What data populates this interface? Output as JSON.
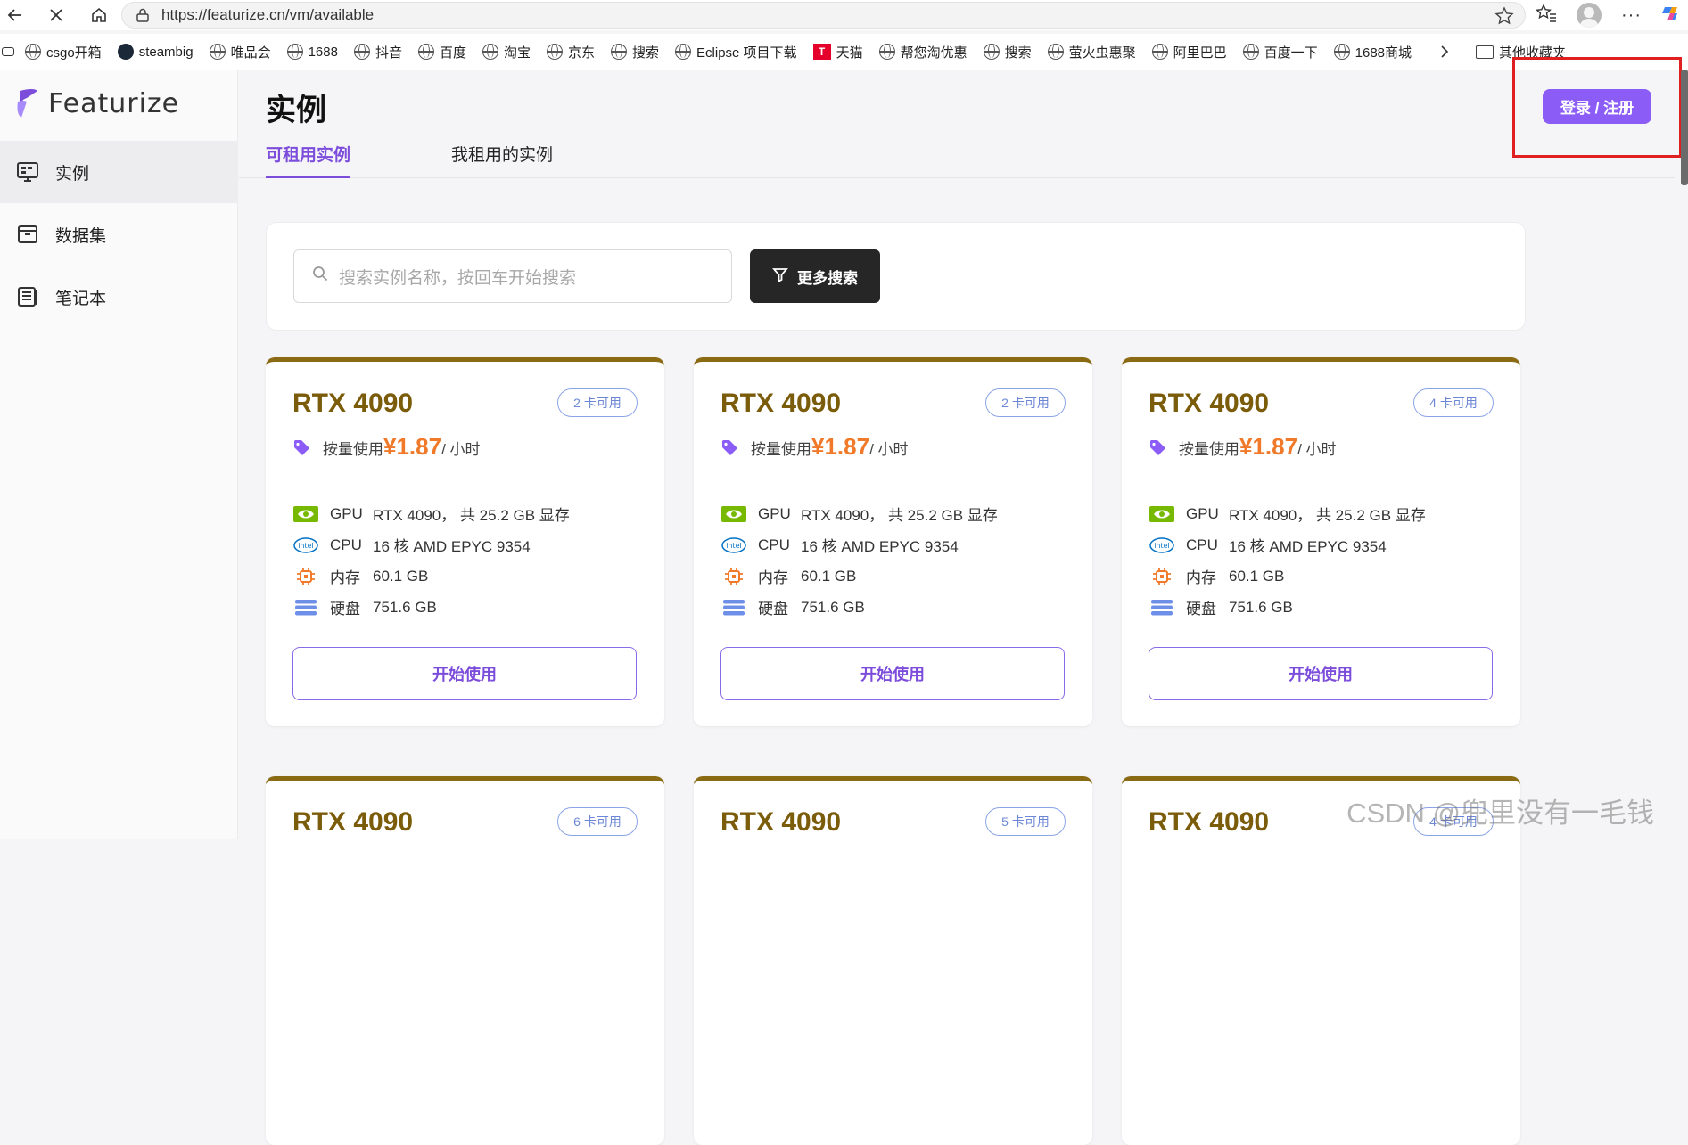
{
  "browser": {
    "url": "https://featurize.cn/vm/available",
    "bookmarks": [
      "csgo开箱",
      "steambig",
      "唯品会",
      "1688",
      "抖音",
      "百度",
      "淘宝",
      "京东",
      "搜索",
      "Eclipse 项目下载",
      "天猫",
      "帮您淘优惠",
      "搜索",
      "萤火虫惠聚",
      "阿里巴巴",
      "百度一下",
      "1688商城"
    ],
    "other_bookmarks": "其他收藏夹"
  },
  "brand": {
    "name": "Featurize",
    "accent": "#8b5cf6"
  },
  "sidebar": {
    "items": [
      {
        "label": "实例",
        "icon": "monitor-icon",
        "active": true
      },
      {
        "label": "数据集",
        "icon": "archive-icon",
        "active": false
      },
      {
        "label": "笔记本",
        "icon": "notebook-icon",
        "active": false
      }
    ]
  },
  "main": {
    "title": "实例",
    "login_label": "登录 / 注册",
    "tabs": [
      "可租用实例",
      "我租用的实例"
    ],
    "search_placeholder": "搜索实例名称，按回车开始搜索",
    "more_search_label": "更多搜索"
  },
  "cards": [
    {
      "title": "RTX 4090",
      "badge": "2 卡可用",
      "price_prefix": "按量使用",
      "price": "¥1.87",
      "price_unit": "/ 小时",
      "gpu_label": "GPU",
      "gpu": "RTX 4090， 共 25.2 GB 显存",
      "cpu_label": "CPU",
      "cpu": "16 核 AMD EPYC 9354",
      "mem_label": "内存",
      "mem": "60.1 GB",
      "disk_label": "硬盘",
      "disk": "751.6 GB",
      "button": "开始使用"
    },
    {
      "title": "RTX 4090",
      "badge": "2 卡可用",
      "price_prefix": "按量使用",
      "price": "¥1.87",
      "price_unit": "/ 小时",
      "gpu_label": "GPU",
      "gpu": "RTX 4090， 共 25.2 GB 显存",
      "cpu_label": "CPU",
      "cpu": "16 核 AMD EPYC 9354",
      "mem_label": "内存",
      "mem": "60.1 GB",
      "disk_label": "硬盘",
      "disk": "751.6 GB",
      "button": "开始使用"
    },
    {
      "title": "RTX 4090",
      "badge": "4 卡可用",
      "price_prefix": "按量使用",
      "price": "¥1.87",
      "price_unit": "/ 小时",
      "gpu_label": "GPU",
      "gpu": "RTX 4090， 共 25.2 GB 显存",
      "cpu_label": "CPU",
      "cpu": "16 核 AMD EPYC 9354",
      "mem_label": "内存",
      "mem": "60.1 GB",
      "disk_label": "硬盘",
      "disk": "751.6 GB",
      "button": "开始使用"
    },
    {
      "title": "RTX 4090",
      "badge": "6 卡可用"
    },
    {
      "title": "RTX 4090",
      "badge": "5 卡可用"
    },
    {
      "title": "RTX 4090",
      "badge": "4 卡可用"
    }
  ],
  "watermark": "CSDN @兜里没有一毛钱"
}
